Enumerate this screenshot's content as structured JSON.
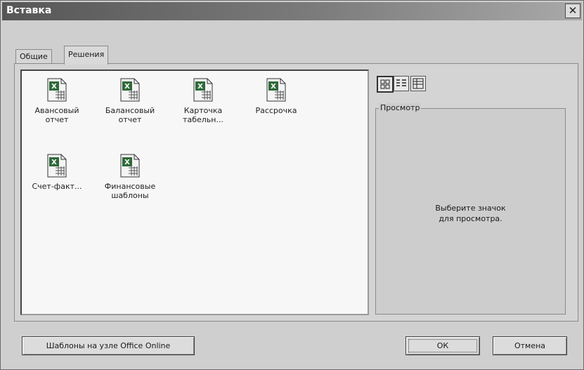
{
  "window": {
    "title": "Вставка",
    "close_symbol": "✕"
  },
  "tabs": [
    {
      "label": "Общие",
      "active": false
    },
    {
      "label": "Решения",
      "active": true
    }
  ],
  "files": [
    {
      "label": "Авансовый отчет",
      "icon": "excel-template-icon"
    },
    {
      "label": "Балансовый отчет",
      "icon": "excel-template-icon"
    },
    {
      "label": "Карточка табельн...",
      "icon": "excel-template-icon"
    },
    {
      "label": "Рассрочка",
      "icon": "excel-template-icon"
    },
    {
      "label": "Счет-факт...",
      "icon": "excel-template-icon"
    },
    {
      "label": "Финансовые шаблоны",
      "icon": "excel-template-icon"
    }
  ],
  "view_buttons": [
    {
      "name": "large-icons",
      "active": true
    },
    {
      "name": "list",
      "active": false
    },
    {
      "name": "details",
      "active": false
    }
  ],
  "preview": {
    "legend": "Просмотр",
    "hint": "Выберите значок\nдля просмотра."
  },
  "buttons": {
    "online_templates": "Шаблоны на узле Office Online",
    "ok": "ОК",
    "cancel": "Отмена"
  },
  "colors": {
    "icon_green": "#2f6a3a",
    "icon_paper": "#f4f4f4"
  }
}
